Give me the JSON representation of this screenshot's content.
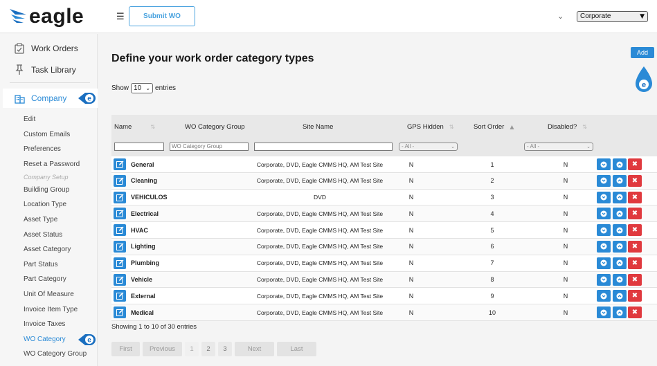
{
  "header": {
    "logo_text": "eagle",
    "submit_label": "Submit WO",
    "site_selected": "Corporate"
  },
  "sidebar": {
    "main_items": [
      {
        "label": "Work Orders",
        "icon": "clipboard-check-icon"
      },
      {
        "label": "Task Library",
        "icon": "pin-icon"
      }
    ],
    "company": {
      "label": "Company",
      "icon": "building-icon"
    },
    "sub_items": [
      {
        "label": "Edit"
      },
      {
        "label": "Custom Emails"
      },
      {
        "label": "Preferences"
      },
      {
        "label": "Reset a Password"
      },
      {
        "label": "Company Setup"
      },
      {
        "label": "Building Group"
      },
      {
        "label": "Location Type"
      },
      {
        "label": "Asset Type"
      },
      {
        "label": "Asset Status"
      },
      {
        "label": "Asset Category"
      },
      {
        "label": "Part Status"
      },
      {
        "label": "Part Category"
      },
      {
        "label": "Unit Of Measure"
      },
      {
        "label": "Invoice Item Type"
      },
      {
        "label": "Invoice Taxes"
      },
      {
        "label": "WO Category"
      },
      {
        "label": "WO Category Group"
      }
    ]
  },
  "main": {
    "title": "Define your work order category types",
    "add_label": "Add",
    "show_label": "Show",
    "entries_label": "entries",
    "page_length": "10",
    "columns": [
      "Name",
      "WO Category Group",
      "Site Name",
      "GPS Hidden",
      "Sort Order",
      "Disabled?"
    ],
    "filters": {
      "group_placeholder": "WO Category Group",
      "gps_all": "- All -",
      "disabled_all": "- All -"
    },
    "rows": [
      {
        "name": "General",
        "site": "Corporate, DVD, Eagle CMMS HQ, AM Test Site",
        "gps": "N",
        "sort": "1",
        "disabled": "N"
      },
      {
        "name": "Cleaning",
        "site": "Corporate, DVD, Eagle CMMS HQ, AM Test Site",
        "gps": "N",
        "sort": "2",
        "disabled": "N"
      },
      {
        "name": "VEHICULOS",
        "site": "DVD",
        "gps": "N",
        "sort": "3",
        "disabled": "N"
      },
      {
        "name": "Electrical",
        "site": "Corporate, DVD, Eagle CMMS HQ, AM Test Site",
        "gps": "N",
        "sort": "4",
        "disabled": "N"
      },
      {
        "name": "HVAC",
        "site": "Corporate, DVD, Eagle CMMS HQ, AM Test Site",
        "gps": "N",
        "sort": "5",
        "disabled": "N"
      },
      {
        "name": "Lighting",
        "site": "Corporate, DVD, Eagle CMMS HQ, AM Test Site",
        "gps": "N",
        "sort": "6",
        "disabled": "N"
      },
      {
        "name": "Plumbing",
        "site": "Corporate, DVD, Eagle CMMS HQ, AM Test Site",
        "gps": "N",
        "sort": "7",
        "disabled": "N"
      },
      {
        "name": "Vehicle",
        "site": "Corporate, DVD, Eagle CMMS HQ, AM Test Site",
        "gps": "N",
        "sort": "8",
        "disabled": "N"
      },
      {
        "name": "External",
        "site": "Corporate, DVD, Eagle CMMS HQ, AM Test Site",
        "gps": "N",
        "sort": "9",
        "disabled": "N"
      },
      {
        "name": "Medical",
        "site": "Corporate, DVD, Eagle CMMS HQ, AM Test Site",
        "gps": "N",
        "sort": "10",
        "disabled": "N"
      }
    ],
    "showing_text": "Showing 1 to 10 of 30 entries",
    "pager": {
      "first": "First",
      "previous": "Previous",
      "pages": [
        "1",
        "2",
        "3"
      ],
      "next": "Next",
      "last": "Last"
    },
    "colors": {
      "accent": "#2a8ad6",
      "danger": "#e0393e"
    }
  }
}
